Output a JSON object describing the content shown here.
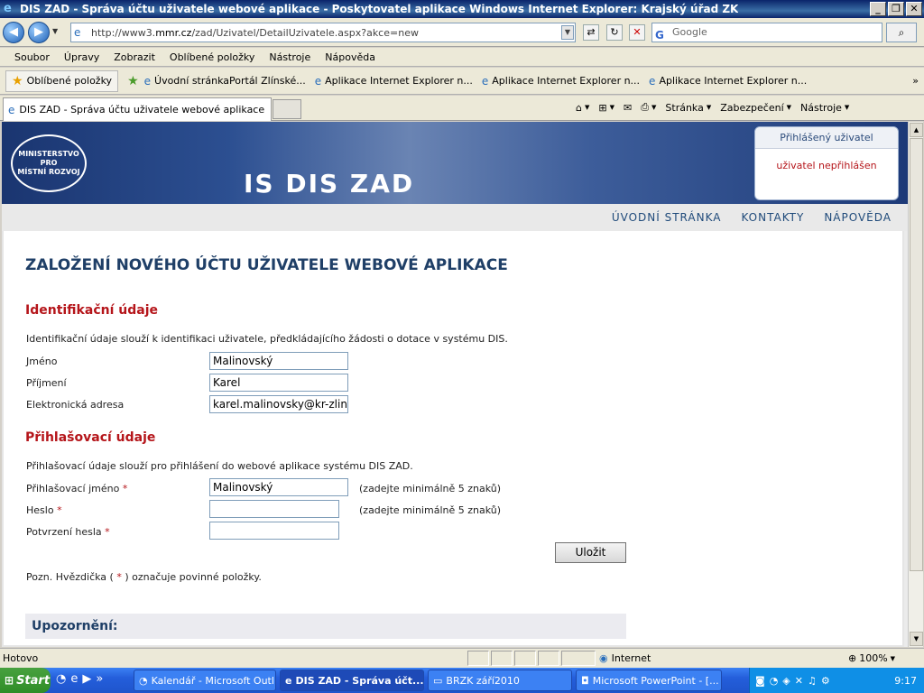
{
  "window": {
    "title": "DIS ZAD - Správa účtu uživatele webové aplikace - Poskytovatel aplikace Windows Internet Explorer: Krajský úřad ZK",
    "buttons": [
      "_",
      "❐",
      "✕"
    ]
  },
  "address_bar": {
    "url_prefix": "http://www3.",
    "url_domain": "mmr.cz",
    "url_suffix": "/zad/Uzivatel/DetailUzivatele.aspx?akce=new",
    "search_placeholder": "Google"
  },
  "menu": [
    "Soubor",
    "Úpravy",
    "Zobrazit",
    "Oblíbené položky",
    "Nástroje",
    "Nápověda"
  ],
  "favorites": {
    "main_label": "Oblíbené položky",
    "links": [
      "Úvodní stránkaPortál Zlínské...",
      "Aplikace Internet Explorer n...",
      "Aplikace Internet Explorer n...",
      "Aplikace Internet Explorer n..."
    ],
    "more": "»"
  },
  "tab": {
    "title": "DIS ZAD - Správa účtu uživatele webové aplikace"
  },
  "command_bar": {
    "page": "Stránka",
    "safety": "Zabezpečení",
    "tools": "Nástroje"
  },
  "page": {
    "logo_lines": [
      "MINISTERSTVO",
      "PRO",
      "MÍSTNÍ ROZVOJ"
    ],
    "banner_title": "IS DIS ZAD",
    "user_box": {
      "heading": "Přihlášený uživatel",
      "value": "uživatel nepřihlášen"
    },
    "nav": [
      "ÚVODNÍ STRÁNKA",
      "KONTAKTY",
      "NÁPOVĚDA"
    ],
    "title": "ZALOŽENÍ NOVÉHO ÚČTU UŽIVATELE WEBOVÉ APLIKACE",
    "identification": {
      "heading": "Identifikační údaje",
      "description": "Identifikační údaje slouží k identifikaci uživatele, předkládajícího žádosti o dotace v systému DIS.",
      "fields": [
        {
          "label": "Jméno",
          "value": "Malinovský"
        },
        {
          "label": "Příjmení",
          "value": "Karel"
        },
        {
          "label": "Elektronická adresa",
          "value": "karel.malinovsky@kr-zlins"
        }
      ]
    },
    "login": {
      "heading": "Přihlašovací údaje",
      "description": "Přihlašovací údaje slouží pro přihlášení do webové aplikace systému DIS ZAD.",
      "fields": [
        {
          "label": "Přihlašovací jméno",
          "value": "Malinovský",
          "hint": "(zadejte minimálně 5 znaků)"
        },
        {
          "label": "Heslo",
          "value": "",
          "hint": "(zadejte minimálně 5 znaků)"
        },
        {
          "label": "Potvrzení hesla",
          "value": ""
        }
      ],
      "required_mark": "*"
    },
    "save_label": "Uložit",
    "note_before": "Pozn. Hvězdička (",
    "note_star": "*",
    "note_after": ") označuje povinné položky.",
    "warning_heading": "Upozornění:"
  },
  "status": {
    "text": "Hotovo",
    "zone": "Internet",
    "zoom": "100%"
  },
  "taskbar": {
    "start": "Start",
    "tasks": [
      "Kalendář - Microsoft Outl...",
      "DIS ZAD - Správa účt...",
      "BRZK září2010",
      "Microsoft PowerPoint - [..."
    ],
    "clock": "9:17"
  }
}
